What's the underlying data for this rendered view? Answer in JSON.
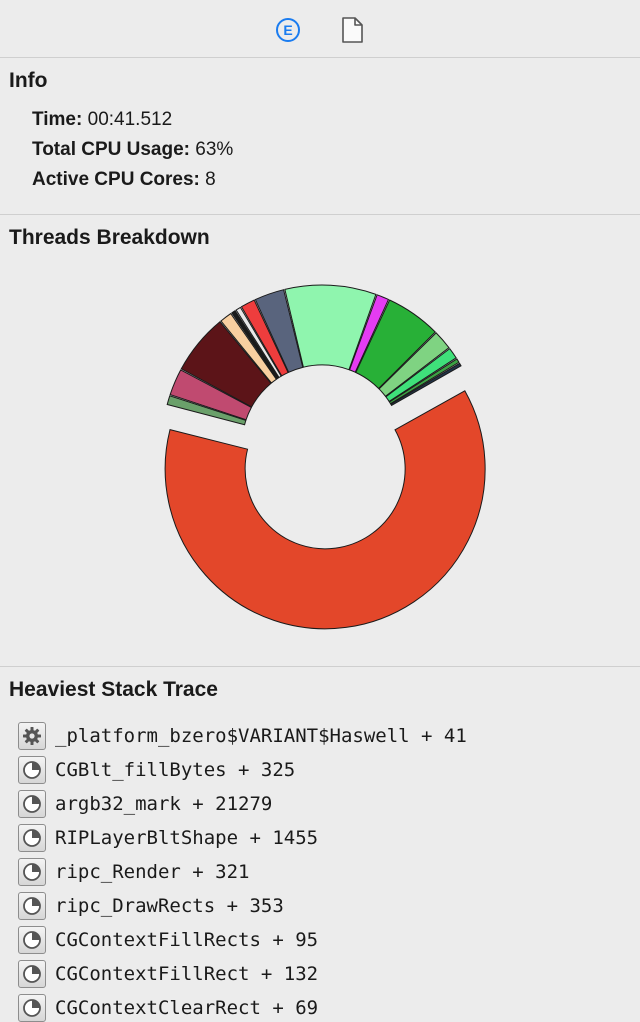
{
  "toolbar": {
    "items": [
      {
        "icon": "events-icon",
        "glyph": "E",
        "selected": true,
        "color": "#1a7cf0"
      },
      {
        "icon": "document-icon",
        "selected": false
      }
    ]
  },
  "info": {
    "title": "Info",
    "rows": [
      {
        "key": "Time:",
        "value": "00:41.512"
      },
      {
        "key": "Total CPU Usage:",
        "value": "63%"
      },
      {
        "key": "Active CPU Cores:",
        "value": "8"
      }
    ]
  },
  "threads": {
    "title": "Threads Breakdown",
    "chart_data": {
      "type": "pie",
      "variant": "donut",
      "slices": [
        {
          "value": 60,
          "color": "#e3472a",
          "exploded": true
        },
        {
          "value": 1.0,
          "color": "#6aa06a"
        },
        {
          "value": 2.7,
          "color": "#c04a70"
        },
        {
          "value": 6.0,
          "color": "#5c1418"
        },
        {
          "value": 1.3,
          "color": "#f8cfa0"
        },
        {
          "value": 0.5,
          "color": "#1a1a1a"
        },
        {
          "value": 0.6,
          "color": "#e8e8e8"
        },
        {
          "value": 1.5,
          "color": "#ee3d3d"
        },
        {
          "value": 3.0,
          "color": "#59647d"
        },
        {
          "value": 9.0,
          "color": "#8ff5ae"
        },
        {
          "value": 1.3,
          "color": "#e43cf2"
        },
        {
          "value": 5.5,
          "color": "#28b037"
        },
        {
          "value": 2.0,
          "color": "#7fd382"
        },
        {
          "value": 1.2,
          "color": "#3fe07a"
        },
        {
          "value": 0.5,
          "color": "#3da244"
        },
        {
          "value": 0.4,
          "color": "#203247"
        }
      ]
    }
  },
  "trace": {
    "title": "Heaviest Stack Trace",
    "items": [
      {
        "icon": "gear-icon",
        "text": "_platform_bzero$VARIANT$Haswell + 41"
      },
      {
        "icon": "pie-icon",
        "text": "CGBlt_fillBytes + 325"
      },
      {
        "icon": "pie-icon",
        "text": "argb32_mark + 21279"
      },
      {
        "icon": "pie-icon",
        "text": "RIPLayerBltShape + 1455"
      },
      {
        "icon": "pie-icon",
        "text": "ripc_Render + 321"
      },
      {
        "icon": "pie-icon",
        "text": "ripc_DrawRects + 353"
      },
      {
        "icon": "pie-icon",
        "text": "CGContextFillRects + 95"
      },
      {
        "icon": "pie-icon",
        "text": "CGContextFillRect + 132"
      },
      {
        "icon": "pie-icon",
        "text": "CGContextClearRect + 69"
      }
    ]
  }
}
